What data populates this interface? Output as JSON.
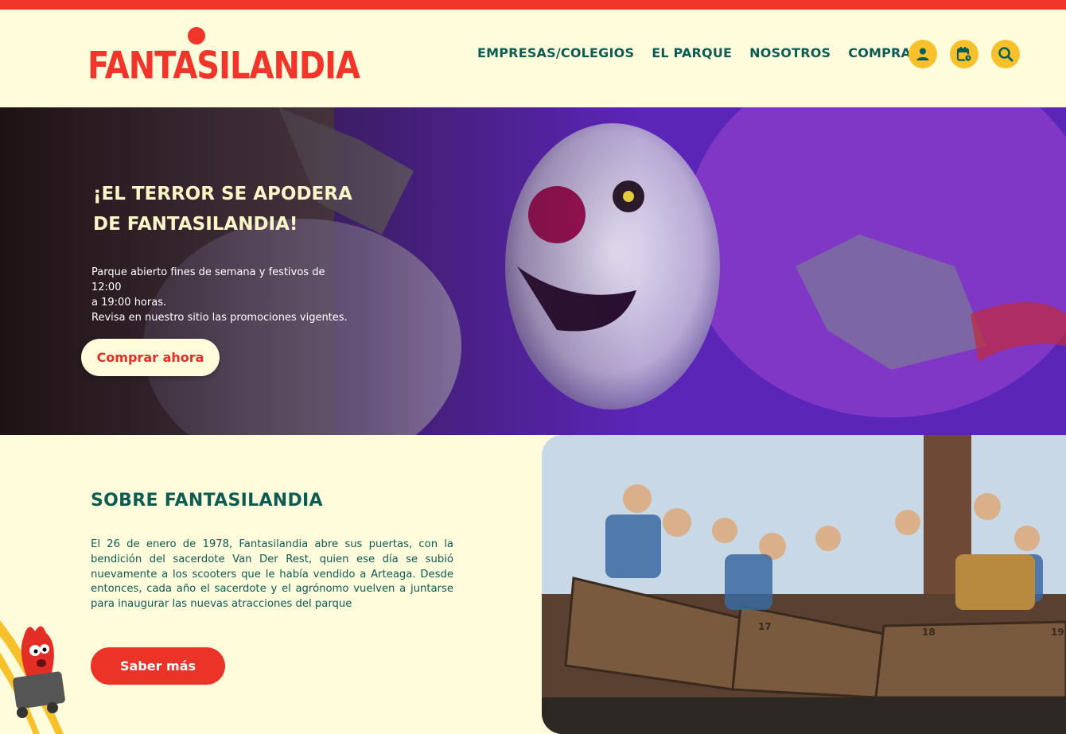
{
  "brand": {
    "logo_text": "FANTASILANDIA",
    "red": "#f1352a",
    "green": "#0c5c54",
    "yellow": "#f8c12b",
    "cream": "#fffcdc"
  },
  "nav": {
    "items": [
      "EMPRESAS/COLEGIOS",
      "EL PARQUE",
      "NOSOTROS",
      "COMPRAR"
    ],
    "icons": [
      "user-icon",
      "calendar-clock-icon",
      "search-icon"
    ]
  },
  "hero": {
    "title_line1": "¡EL TERROR SE APODERA",
    "title_line2": "DE FANTASILANDIA!",
    "info_line1": "Parque abierto fines de semana y festivos de 12:00",
    "info_line2": "a 19:00 horas.",
    "info_line3": "Revisa en nuestro sitio las promociones vigentes.",
    "cta": "Comprar ahora"
  },
  "about": {
    "title": "SOBRE FANTASILANDIA",
    "body": "El 26 de enero de 1978, Fantasilandia abre sus puertas, con la bendición del sacerdote Van Der Rest, quien ese día se subió nuevamente a los scooters que le había vendido a Arteaga. Desde entonces, cada año el sacerdote y el agrónomo vuelven a juntarse para inaugurar las nuevas atracciones del parque",
    "cta": "Saber más"
  },
  "photo": {
    "car_numbers": [
      "17",
      "18",
      "19"
    ]
  }
}
